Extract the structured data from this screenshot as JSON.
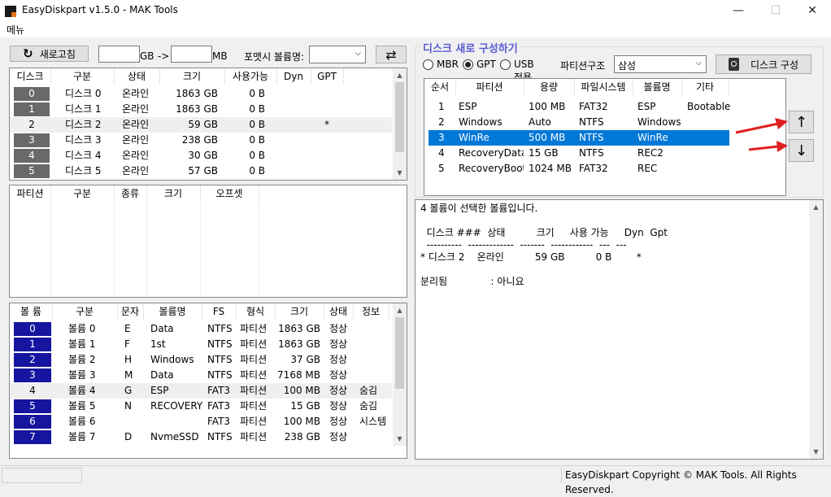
{
  "window": {
    "title": "EasyDiskpart v1.5.0 - MAK Tools",
    "minimize": "—",
    "maximize": "☐",
    "close": "✕"
  },
  "menu": {
    "label": "메뉴"
  },
  "toolbar": {
    "refresh_label": "새로고침",
    "gb_unit": "GB",
    "arrow_text": "->",
    "mb_unit": "MB",
    "format_label": "포맷시 볼륨명:",
    "swap_icon": "⇄"
  },
  "disk_table": {
    "headers": [
      "디스크",
      "구분",
      "상태",
      "크기",
      "사용가능",
      "Dyn",
      "GPT"
    ],
    "rows": [
      {
        "num": "0",
        "name": "디스크 0",
        "status": "온라인",
        "size": "1863 GB",
        "free": "0 B",
        "dyn": "",
        "gpt": ""
      },
      {
        "num": "1",
        "name": "디스크 1",
        "status": "온라인",
        "size": "1863 GB",
        "free": "0 B",
        "dyn": "",
        "gpt": ""
      },
      {
        "num": "2",
        "name": "디스크 2",
        "status": "온라인",
        "size": "59 GB",
        "free": "0 B",
        "dyn": "",
        "gpt": "*"
      },
      {
        "num": "3",
        "name": "디스크 3",
        "status": "온라인",
        "size": "238 GB",
        "free": "0 B",
        "dyn": "",
        "gpt": ""
      },
      {
        "num": "4",
        "name": "디스크 4",
        "status": "온라인",
        "size": "30 GB",
        "free": "0 B",
        "dyn": "",
        "gpt": ""
      },
      {
        "num": "5",
        "name": "디스크 5",
        "status": "온라인",
        "size": "57 GB",
        "free": "0 B",
        "dyn": "",
        "gpt": ""
      }
    ]
  },
  "partition_table": {
    "headers": [
      "파티션",
      "구분",
      "종류",
      "크기",
      "오프셋"
    ]
  },
  "volume_table": {
    "headers": [
      "볼 륨",
      "구분",
      "문자",
      "볼륨명",
      "FS",
      "형식",
      "크기",
      "상태",
      "정보"
    ],
    "rows": [
      {
        "num": "0",
        "name": "볼륨 0",
        "letter": "E",
        "label": "Data",
        "fs": "NTFS",
        "type": "파티션",
        "size": "1863 GB",
        "status": "정상",
        "info": ""
      },
      {
        "num": "1",
        "name": "볼륨 1",
        "letter": "F",
        "label": "1st",
        "fs": "NTFS",
        "type": "파티션",
        "size": "1863 GB",
        "status": "정상",
        "info": ""
      },
      {
        "num": "2",
        "name": "볼륨 2",
        "letter": "H",
        "label": "Windows",
        "fs": "NTFS",
        "type": "파티션",
        "size": "37 GB",
        "status": "정상",
        "info": ""
      },
      {
        "num": "3",
        "name": "볼륨 3",
        "letter": "M",
        "label": "Data",
        "fs": "NTFS",
        "type": "파티션",
        "size": "7168 MB",
        "status": "정상",
        "info": ""
      },
      {
        "num": "4",
        "name": "볼륨 4",
        "letter": "G",
        "label": "ESP",
        "fs": "FAT3",
        "type": "파티션",
        "size": "100 MB",
        "status": "정상",
        "info": "숨김"
      },
      {
        "num": "5",
        "name": "볼륨 5",
        "letter": "N",
        "label": "RECOVERY",
        "fs": "FAT3",
        "type": "파티션",
        "size": "15 GB",
        "status": "정상",
        "info": "숨김"
      },
      {
        "num": "6",
        "name": "볼륨 6",
        "letter": "",
        "label": "",
        "fs": "FAT3",
        "type": "파티션",
        "size": "100 MB",
        "status": "정상",
        "info": "시스템"
      },
      {
        "num": "7",
        "name": "볼륨 7",
        "letter": "D",
        "label": "NvmeSSD",
        "fs": "NTFS",
        "type": "파티션",
        "size": "238 GB",
        "status": "정상",
        "info": ""
      }
    ]
  },
  "reconfig": {
    "group_title": "디스크 새로 구성하기",
    "mbr_label": "MBR",
    "gpt_label": "GPT",
    "usb_label": "USB전용",
    "structure_label": "파티션구조",
    "structure_value": "삼성",
    "build_button": "디스크 구성",
    "up_icon": "↑",
    "down_icon": "↓",
    "headers": [
      "순서",
      "파티션",
      "용량",
      "파일시스템",
      "볼륨명",
      "기타"
    ],
    "rows": [
      {
        "order": "1",
        "name": "ESP",
        "size": "100 MB",
        "fs": "FAT32",
        "label": "ESP",
        "etc": "Bootable"
      },
      {
        "order": "2",
        "name": "Windows",
        "size": "Auto",
        "fs": "NTFS",
        "label": "Windows",
        "etc": ""
      },
      {
        "order": "3",
        "name": "WinRe",
        "size": "500 MB",
        "fs": "NTFS",
        "label": "WinRe",
        "etc": ""
      },
      {
        "order": "4",
        "name": "RecoveryData",
        "size": "15 GB",
        "fs": "NTFS",
        "label": "REC2",
        "etc": ""
      },
      {
        "order": "5",
        "name": "RecoveryBoot",
        "size": "1024 MB",
        "fs": "FAT32",
        "label": "REC",
        "etc": ""
      }
    ]
  },
  "output": {
    "lines": [
      "4 볼륨이 선택한 볼륨입니다.",
      "",
      "  디스크 ###  상태          크기     사용 가능     Dyn  Gpt",
      "  ----------  -------------  -------  ------------  ---  ---",
      "* 디스크 2    온라인          59 GB          0 B        *",
      "",
      "분리됨              : 아니요"
    ]
  },
  "statusbar": {
    "copyright": "EasyDiskpart Copyright © MAK Tools. All Rights Reserved."
  },
  "colors": {
    "highlight_blue": "#0078d7",
    "numcell_gray": "#696969",
    "numcell_navy": "#1515a0",
    "group_title": "#5a5ad6",
    "annotation_red": "#e02020"
  }
}
